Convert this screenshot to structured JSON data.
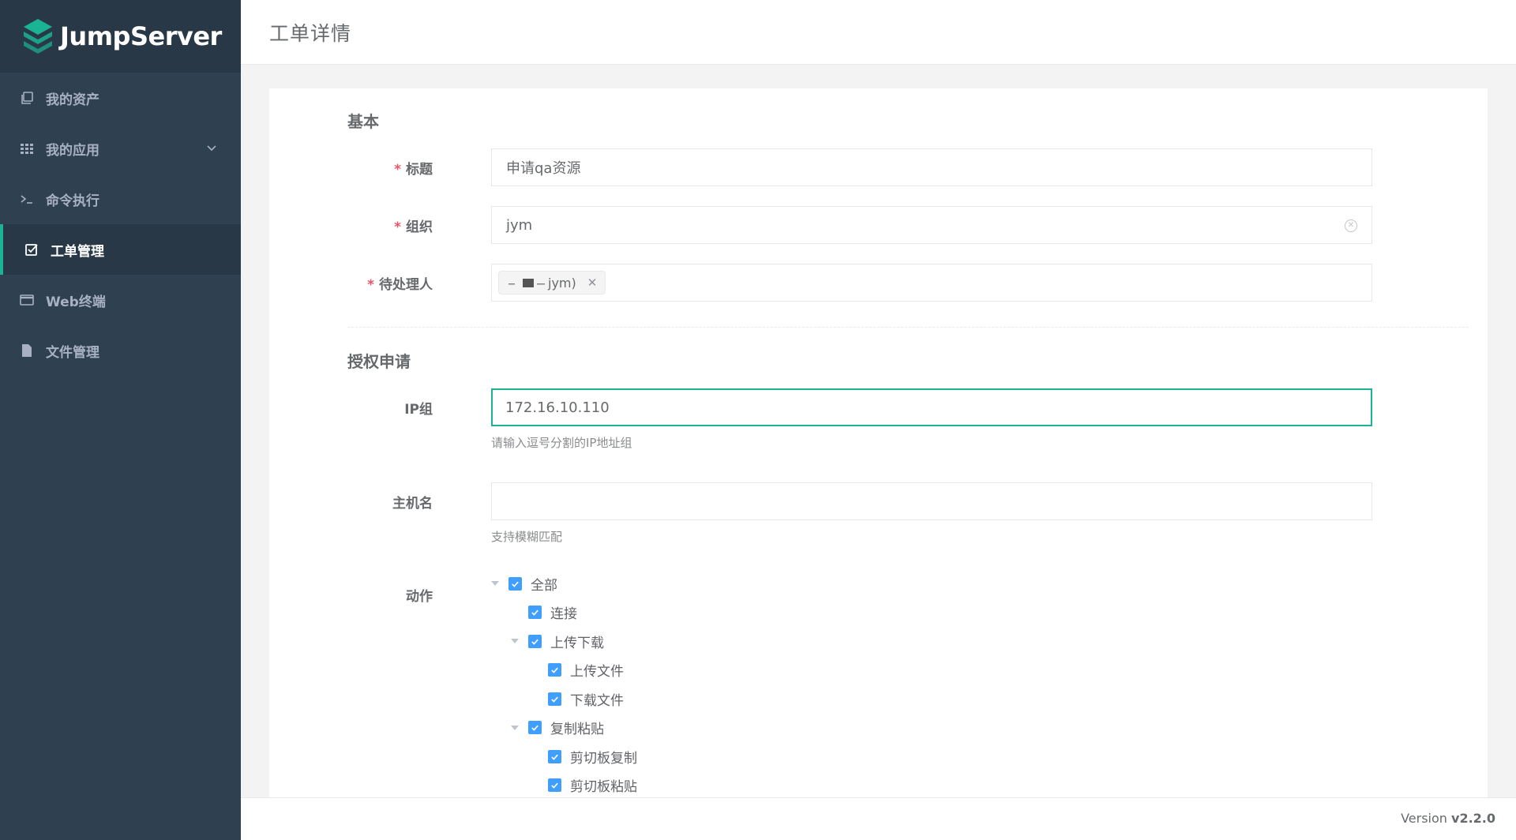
{
  "app": {
    "name": "JumpServer"
  },
  "sidebar": {
    "items": [
      {
        "label": "我的资产",
        "icon": "assets-icon",
        "active": false
      },
      {
        "label": "我的应用",
        "icon": "grid-icon",
        "active": false,
        "expandable": true
      },
      {
        "label": "命令执行",
        "icon": "terminal-icon",
        "active": false
      },
      {
        "label": "工单管理",
        "icon": "checkbox-icon",
        "active": true
      },
      {
        "label": "Web终端",
        "icon": "window-icon",
        "active": false
      },
      {
        "label": "文件管理",
        "icon": "file-icon",
        "active": false
      }
    ]
  },
  "header": {
    "title": "工单详情"
  },
  "form": {
    "basic": {
      "section_title": "基本",
      "title_label": "标题",
      "title_value": "申请qa资源",
      "org_label": "组织",
      "org_value": "jym",
      "assignee_label": "待处理人",
      "assignee_tag": "jym)"
    },
    "auth": {
      "section_title": "授权申请",
      "ip_label": "IP组",
      "ip_value": "172.16.10.110",
      "ip_help": "请输入逗号分割的IP地址组",
      "hostname_label": "主机名",
      "hostname_value": "",
      "hostname_help": "支持模糊匹配",
      "actions_label": "动作",
      "actions": [
        {
          "label": "全部",
          "level": 0,
          "expandable": true,
          "checked": true
        },
        {
          "label": "连接",
          "level": 1,
          "expandable": false,
          "checked": true
        },
        {
          "label": "上传下载",
          "level": 1,
          "expandable": true,
          "checked": true
        },
        {
          "label": "上传文件",
          "level": 2,
          "expandable": false,
          "checked": true
        },
        {
          "label": "下载文件",
          "level": 2,
          "expandable": false,
          "checked": true
        },
        {
          "label": "复制粘贴",
          "level": 1,
          "expandable": true,
          "checked": true
        },
        {
          "label": "剪切板复制",
          "level": 2,
          "expandable": false,
          "checked": true
        },
        {
          "label": "剪切板粘贴",
          "level": 2,
          "expandable": false,
          "checked": true
        }
      ]
    }
  },
  "footer": {
    "version_prefix": "Version",
    "version": "v2.2.0"
  },
  "colors": {
    "sidebar": "#2f4050",
    "accent": "#1ab394",
    "checkbox": "#409eff",
    "required": "#ed5565"
  }
}
